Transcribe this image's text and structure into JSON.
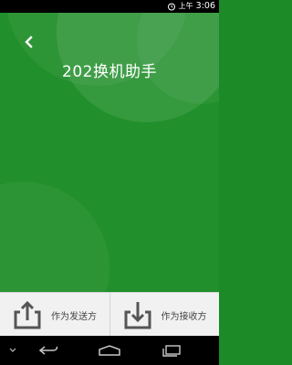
{
  "status_bar": {
    "ampm": "上午",
    "time": "3:06",
    "icons": [
      "alarm-icon"
    ]
  },
  "header": {
    "title": "202换机助手",
    "back_icon": "chevron-left-icon"
  },
  "actions": {
    "send_label": "作为发送方",
    "send_icon": "upload-icon",
    "receive_label": "作为接收方",
    "receive_icon": "download-icon"
  },
  "nav_bar": {
    "icons": [
      "menu-chevron-icon",
      "back-icon",
      "home-icon",
      "recent-apps-icon"
    ]
  },
  "colors": {
    "primary_green": "#218f2b",
    "action_bar_bg": "#f1f1f1",
    "icon_gray": "#555555"
  }
}
